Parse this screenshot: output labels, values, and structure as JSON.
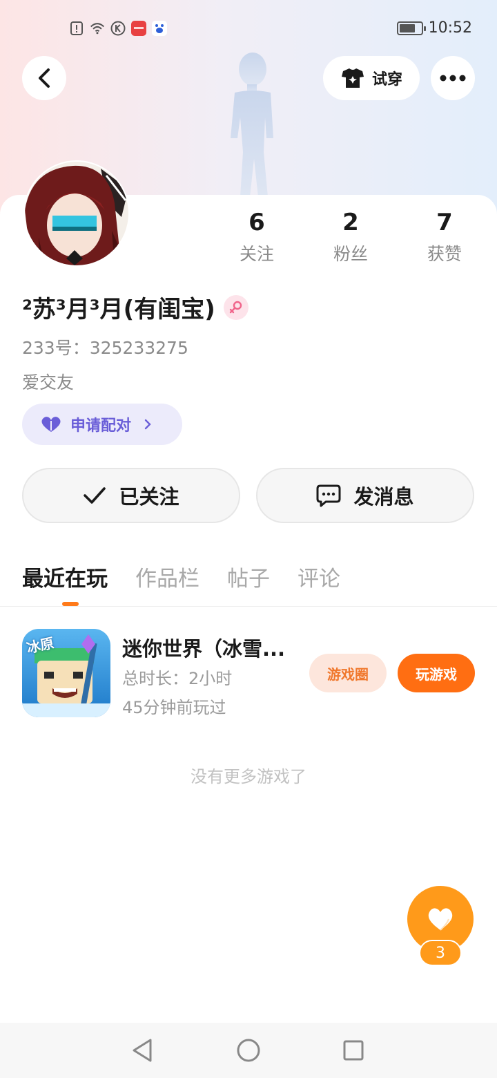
{
  "status_bar": {
    "time": "10:52",
    "battery_level": 0.75,
    "icons": [
      "alert-icon",
      "wifi-icon",
      "k-app-icon",
      "huawei-app-icon",
      "baidu-app-icon"
    ]
  },
  "header": {
    "try_on_label": "试穿"
  },
  "stats": [
    {
      "value": "6",
      "label": "关注"
    },
    {
      "value": "2",
      "label": "粉丝"
    },
    {
      "value": "7",
      "label": "获赞"
    }
  ],
  "profile": {
    "username": "²苏³月³月(有闺宝)",
    "uid": "233号：325233275",
    "bio": "爱交友",
    "pair_label": "申请配对"
  },
  "actions": {
    "followed_label": "已关注",
    "message_label": "发消息"
  },
  "tabs": [
    "最近在玩",
    "作品栏",
    "帖子",
    "评论"
  ],
  "game": {
    "title": "迷你世界（冰雪...",
    "playtime": "总时长：2小时",
    "last_played": "45分钟前玩过",
    "circle_label": "游戏圈",
    "play_label": "玩游戏",
    "icon_text": "冰原"
  },
  "footer": {
    "no_more": "没有更多游戏了"
  },
  "fab": {
    "count": "3"
  },
  "colors": {
    "accent_orange": "#ff6e12",
    "pair_purple": "#6a5ed8",
    "fab_orange": "#ff9a1a"
  }
}
